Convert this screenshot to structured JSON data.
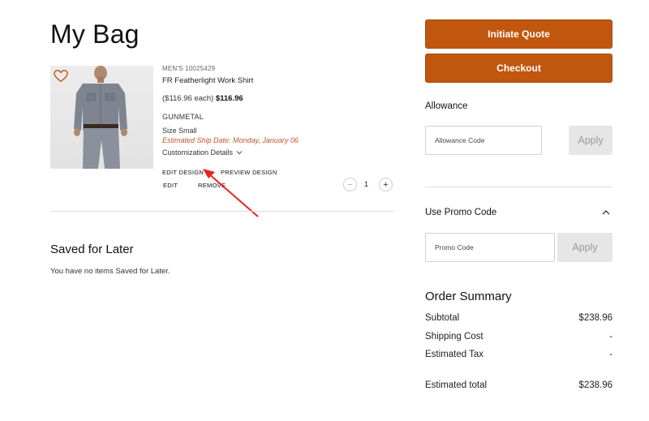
{
  "page": {
    "title": "My Bag"
  },
  "cart_item": {
    "sku": "MEN'S 10025429",
    "name": "FR Featherlight Work Shirt",
    "price_each": "($116.96 each)",
    "price_total": "$116.96",
    "color": "GUNMETAL",
    "size": "Size Small",
    "ship_date": "Estimated Ship Date: Monday, January 06",
    "customization_label": "Customization Details",
    "actions": {
      "edit_design": "EDIT DESIGN",
      "preview_design": "PREVIEW DESIGN",
      "edit": "EDIT",
      "remove": "REMOVE"
    },
    "quantity": "1",
    "qty_minus": "−",
    "qty_plus": "+",
    "icons": {
      "favorite": "heart-icon",
      "chevron": "chevron-down-icon"
    }
  },
  "saved_for_later": {
    "title": "Saved for Later",
    "empty_message": "You have no items Saved for Later."
  },
  "sidebar": {
    "initiate_quote": "Initiate Quote",
    "checkout": "Checkout",
    "allowance": {
      "label": "Allowance",
      "placeholder": "Allowance Code",
      "apply": "Apply"
    },
    "promo": {
      "label": "Use Promo Code",
      "placeholder": "Promo Code",
      "apply": "Apply"
    },
    "order_summary": {
      "title": "Order Summary",
      "subtotal_label": "Subtotal",
      "subtotal_value": "$238.96",
      "shipping_label": "Shipping Cost",
      "shipping_value": "-",
      "tax_label": "Estimated Tax",
      "tax_value": "-",
      "total_label": "Estimated total",
      "total_value": "$238.96"
    }
  },
  "colors": {
    "brand_orange": "#c1570f",
    "ship_date_orange": "#c0562b",
    "annotation_red": "#e8241d",
    "apply_disabled": "#e6e6e6"
  }
}
